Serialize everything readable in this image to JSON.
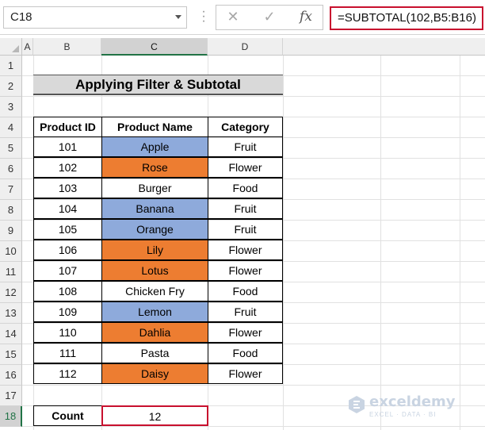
{
  "formula_bar": {
    "name_box": "C18",
    "cancel_icon": "✕",
    "enter_icon": "✓",
    "fx_label": "fx",
    "formula": "=SUBTOTAL(102,B5:B16)"
  },
  "columns": [
    "A",
    "B",
    "C",
    "D"
  ],
  "selected_column": "C",
  "rows": [
    "1",
    "2",
    "3",
    "4",
    "5",
    "6",
    "7",
    "8",
    "9",
    "10",
    "11",
    "12",
    "13",
    "14",
    "15",
    "16",
    "17",
    "18"
  ],
  "selected_row": "18",
  "sheet": {
    "title": "Applying Filter & Subtotal",
    "headers": [
      "Product ID",
      "Product Name",
      "Category"
    ],
    "data": [
      {
        "id": "101",
        "name": "Apple",
        "category": "Fruit",
        "color": "blue"
      },
      {
        "id": "102",
        "name": "Rose",
        "category": "Flower",
        "color": "orange"
      },
      {
        "id": "103",
        "name": "Burger",
        "category": "Food",
        "color": "none"
      },
      {
        "id": "104",
        "name": "Banana",
        "category": "Fruit",
        "color": "blue"
      },
      {
        "id": "105",
        "name": "Orange",
        "category": "Fruit",
        "color": "blue"
      },
      {
        "id": "106",
        "name": "Lily",
        "category": "Flower",
        "color": "orange"
      },
      {
        "id": "107",
        "name": "Lotus",
        "category": "Flower",
        "color": "orange"
      },
      {
        "id": "108",
        "name": "Chicken Fry",
        "category": "Food",
        "color": "none"
      },
      {
        "id": "109",
        "name": "Lemon",
        "category": "Fruit",
        "color": "blue"
      },
      {
        "id": "110",
        "name": "Dahlia",
        "category": "Flower",
        "color": "orange"
      },
      {
        "id": "111",
        "name": "Pasta",
        "category": "Food",
        "color": "none"
      },
      {
        "id": "112",
        "name": "Daisy",
        "category": "Flower",
        "color": "orange"
      }
    ],
    "count_label": "Count",
    "count_value": "12"
  },
  "colors": {
    "fill_blue": "#8eaadb",
    "fill_orange": "#ed7d31",
    "highlight_red": "#c8102e",
    "excel_green": "#217346"
  },
  "watermark": {
    "name": "exceldemy",
    "tagline": "EXCEL · DATA · BI"
  }
}
